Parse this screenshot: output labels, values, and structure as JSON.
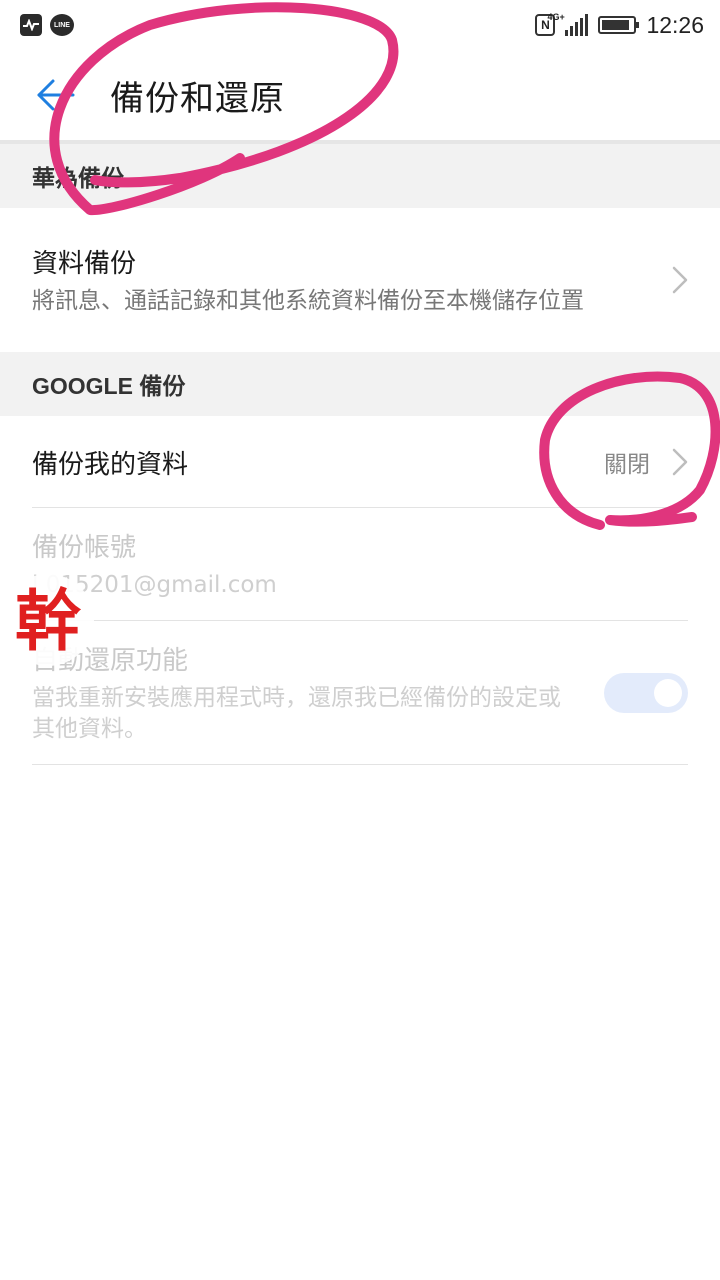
{
  "status_bar": {
    "time": "12:26",
    "line_label": "LINE",
    "nfc_label": "N",
    "network": "4G+",
    "battery_level": 0.9,
    "icons": [
      "activity-notification-icon",
      "line-app-icon",
      "nfc-icon",
      "cellular-signal-icon",
      "battery-icon"
    ]
  },
  "toolbar": {
    "title": "備份和還原",
    "back_icon": "arrow-left-icon"
  },
  "sections": {
    "huawei": {
      "header": "華為備份",
      "item": {
        "title": "資料備份",
        "subtitle": "將訊息、通話記錄和其他系統資料備份至本機儲存位置"
      }
    },
    "google": {
      "header": "GOOGLE 備份",
      "backup_my_data": {
        "title": "備份我的資料",
        "value": "關閉"
      },
      "backup_account": {
        "title": "備份帳號",
        "value": "l   015201@gmail.com"
      },
      "auto_restore": {
        "title": "自動還原功能",
        "subtitle": "當我重新安裝應用程式時，還原我已經備份的設定或其他資料。",
        "enabled": true
      }
    }
  },
  "stamp": {
    "text": "幹"
  },
  "colors": {
    "accent": "#1f7fe0",
    "annotation": "#e0357d",
    "stamp_red": "#e02020"
  }
}
